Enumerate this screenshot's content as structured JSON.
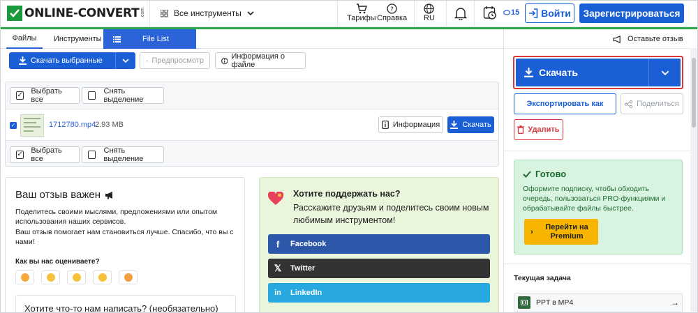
{
  "header": {
    "logo_text": "ONLINE-CONVERT",
    "logo_suffix": ".com",
    "tools_label": "Все инструменты",
    "tariffs": "Тарифы",
    "help": "Справка",
    "language": "RU",
    "credits": "15",
    "login": "Войти",
    "register": "Зарегистрироваться"
  },
  "tabs": [
    {
      "label": "Файлы"
    },
    {
      "label": "Инструменты"
    },
    {
      "label": "File List"
    }
  ],
  "toolbar": {
    "download_selected": "Скачать выбранные",
    "preview": "Предпросмотр",
    "file_info": "Информация о файле"
  },
  "file_panel": {
    "select_all": "Выбрать все",
    "deselect": "Снять выделение",
    "files": [
      {
        "name": "1712780.mp4",
        "size": "2.93 MB",
        "info": "Информация",
        "download": "Скачать"
      }
    ]
  },
  "feedback": {
    "title": "Ваш отзыв важен",
    "text1": "Поделитесь своими мыслями, предложениями или опытом использования наших сервисов.",
    "text2": "Ваш отзыв помогает нам становиться лучше. Спасибо, что вы с нами!",
    "question": "Как вы нас оцениваете?",
    "comment_title": "Хотите что-то нам написать? (необязательно)"
  },
  "support": {
    "title": "Хотите поддержать нас?",
    "text": "Расскажите друзьям и поделитесь своим новым любимым инструментом!",
    "facebook": "Facebook",
    "twitter": "Twitter",
    "linkedin": "LinkedIn"
  },
  "right_panel": {
    "review": "Оставьте отзыв",
    "download": "Скачать",
    "export": "Экспортировать как",
    "share": "Поделиться",
    "delete": "Удалить",
    "ready_title": "Готово",
    "ready_text": "Оформите подписку, чтобы обходить очередь, пользоваться PRO-функциями и обрабатывайте файлы быстрее.",
    "premium_line1": "Перейти на",
    "premium_line2": "Premium",
    "current_task_title": "Текущая задача",
    "current_task": "PPT в MP4"
  },
  "colors": {
    "brand_green": "#2ea84a",
    "primary_blue": "#1a5fd6",
    "danger_red": "#d9363e",
    "premium_yellow": "#f7b500"
  }
}
